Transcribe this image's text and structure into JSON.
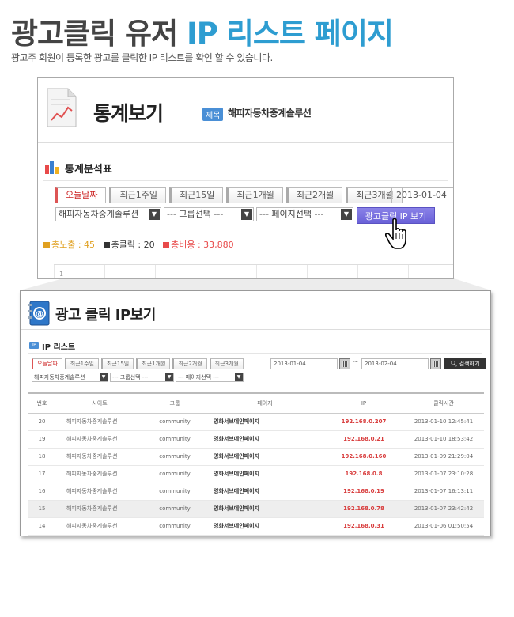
{
  "hero": {
    "title_a": "광고클릭 유저 ",
    "title_b": "IP 리스트 페이지",
    "subtitle": "광고주 회원이 등록한 광고를 클릭한 IP 리스트를 확인 할 수 있습니다."
  },
  "panel1": {
    "title": "통계보기",
    "tag": "제목",
    "tag_text": "해피자동차중계솔루션",
    "section": "통계분석표",
    "tabs": [
      "오늘날짜",
      "최근1주일",
      "최근15일",
      "최근1개월",
      "최근2개월",
      "최근3개월"
    ],
    "date": "2013-01-04",
    "selects": [
      "해피자동차중계솔루션",
      "--- 그룹선택 ---",
      "--- 페이지선택 ---"
    ],
    "ip_button": "광고클릭 IP 보기",
    "stats": {
      "impressions": "총노출 : 45",
      "clicks": "총클릭 : 20",
      "cost": "총비용 : 33,880"
    },
    "chart_tick": "1"
  },
  "panel2": {
    "title": "광고 클릭 IP보기",
    "ip_badge": "IP",
    "section": "IP 리스트",
    "tabs": [
      "오늘날짜",
      "최근1주일",
      "최근15일",
      "최근1개월",
      "최근2개월",
      "최근3개월"
    ],
    "date_from": "2013-01-04",
    "tilde": "~",
    "date_to": "2013-02-04",
    "search_button": "검색하기",
    "selects": [
      "해피자동차중계솔루션",
      "--- 그룹선택 ---",
      "--- 페이지선택 ---"
    ],
    "columns": [
      "번호",
      "사이트",
      "그룹",
      "페이지",
      "IP",
      "클릭시간"
    ],
    "rows": [
      {
        "no": "20",
        "site": "해피자동차중계솔루션",
        "group": "community",
        "page": "영화서브메인페이지",
        "ip": "192.168.0.207",
        "time": "2013-01-10 12:45:41"
      },
      {
        "no": "19",
        "site": "해피자동차중계솔루션",
        "group": "community",
        "page": "영화서브메인페이지",
        "ip": "192.168.0.21",
        "time": "2013-01-10 18:53:42"
      },
      {
        "no": "18",
        "site": "해피자동차중계솔루션",
        "group": "community",
        "page": "영화서브메인페이지",
        "ip": "192.168.0.160",
        "time": "2013-01-09 21:29:04"
      },
      {
        "no": "17",
        "site": "해피자동차중계솔루션",
        "group": "community",
        "page": "영화서브메인페이지",
        "ip": "192.168.0.8",
        "time": "2013-01-07 23:10:28"
      },
      {
        "no": "16",
        "site": "해피자동차중계솔루션",
        "group": "community",
        "page": "영화서브메인페이지",
        "ip": "192.168.0.19",
        "time": "2013-01-07 16:13:11"
      },
      {
        "no": "15",
        "site": "해피자동차중계솔루션",
        "group": "community",
        "page": "영화서브메인페이지",
        "ip": "192.168.0.78",
        "time": "2013-01-07 23:42:42"
      },
      {
        "no": "14",
        "site": "해피자동차중계솔루션",
        "group": "community",
        "page": "영화서브메인페이지",
        "ip": "192.168.0.31",
        "time": "2013-01-06 01:50:54"
      }
    ],
    "highlighted_row_index": 5
  },
  "colors": {
    "title_blue": "#2e9dd1",
    "ip_button": "#6a61d8",
    "ip_text": "#d83c3c",
    "impressions": "#e0a020",
    "cost": "#e84a4a"
  }
}
